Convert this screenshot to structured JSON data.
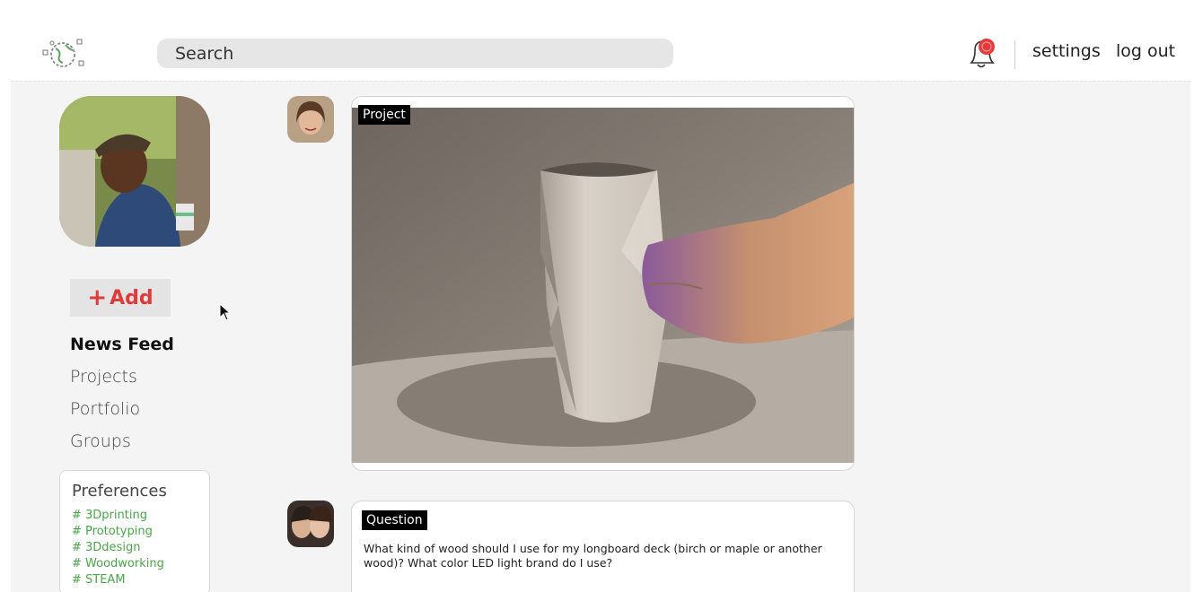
{
  "header": {
    "search_placeholder": "Search",
    "settings_label": "settings",
    "logout_label": "log out"
  },
  "sidebar": {
    "add_label": "Add",
    "nav": [
      {
        "label": "News Feed",
        "active": true
      },
      {
        "label": "Projects",
        "active": false
      },
      {
        "label": "Portfolio",
        "active": false
      },
      {
        "label": "Groups",
        "active": false
      }
    ],
    "preferences": {
      "title": "Preferences",
      "tags": [
        "# 3Dprinting",
        "# Prototyping",
        "# 3Ddesign",
        "# Woodworking",
        "# STEAM"
      ]
    }
  },
  "feed": {
    "posts": [
      {
        "type_label": "Project",
        "image": "3d-printed-vase-photo"
      },
      {
        "type_label": "Question",
        "text": "What kind of wood should I use for my longboard deck (birch or maple or another wood)? What color LED light brand do I use?"
      }
    ]
  },
  "colors": {
    "accent_red": "#e03a3a",
    "tag_green": "#4aa54a",
    "badge_black": "#000000"
  }
}
